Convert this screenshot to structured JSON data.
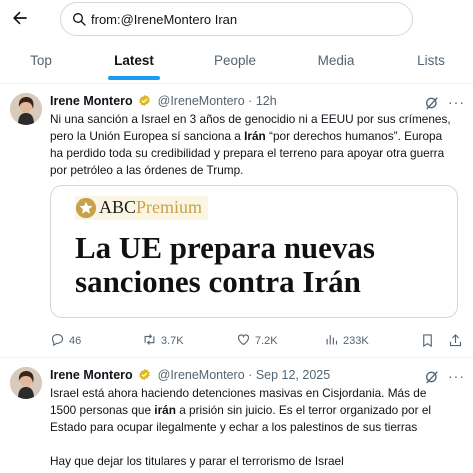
{
  "search": {
    "query": "from:@IreneMontero Iran"
  },
  "tabs": [
    {
      "label": "Top"
    },
    {
      "label": "Latest"
    },
    {
      "label": "People"
    },
    {
      "label": "Media"
    },
    {
      "label": "Lists"
    }
  ],
  "active_tab": "Latest",
  "tweets": [
    {
      "name": "Irene Montero",
      "handle": "@IreneMontero",
      "sep": "·",
      "time": "12h",
      "lines": [
        [
          "Ni una sanción a Israel en 3 años de genocidio ni a EEUU por sus crímenes,"
        ],
        [
          "pero la Unión Europea sí sanciona a ",
          "Irán",
          " “por derechos humanos”.  Europa"
        ],
        [
          "ha perdido toda su credibilidad y prepara el terreno para apoyar otra guerra"
        ],
        [
          "por petróleo a las órdenes de Trump."
        ]
      ],
      "card": {
        "brand_abc": "ABC",
        "brand_premium": "Premium",
        "headline_line1": "La UE prepara nuevas",
        "headline_line2": "sanciones contra Irán"
      },
      "stats": {
        "replies": "46",
        "reposts": "3.7K",
        "likes": "7.2K",
        "views": "233K"
      }
    },
    {
      "name": "Irene Montero",
      "handle": "@IreneMontero",
      "sep": "·",
      "time": "Sep 12, 2025",
      "lines": [
        [
          "Israel está ahora haciendo detenciones masivas en Cisjordania. Más de"
        ],
        [
          "1500 personas que ",
          "irán",
          " a prisión sin juicio. Es el terror organizado por el"
        ],
        [
          "Estado para ocupar ilegalmente y echar a los palestinos de sus tierras"
        ],
        [
          ""
        ],
        [
          "Hay que dejar los titulares y parar el terrorismo de Israel"
        ]
      ]
    }
  ],
  "colors": {
    "accent": "#1d9bf0",
    "muted": "#536471",
    "text": "#0f1419",
    "border": "#eff3f4"
  },
  "icons": [
    "back-arrow-icon",
    "search-icon",
    "verified-badge-icon",
    "grok-icon",
    "more-icon",
    "reply-icon",
    "repost-icon",
    "like-icon",
    "views-icon",
    "bookmark-icon",
    "share-icon"
  ]
}
